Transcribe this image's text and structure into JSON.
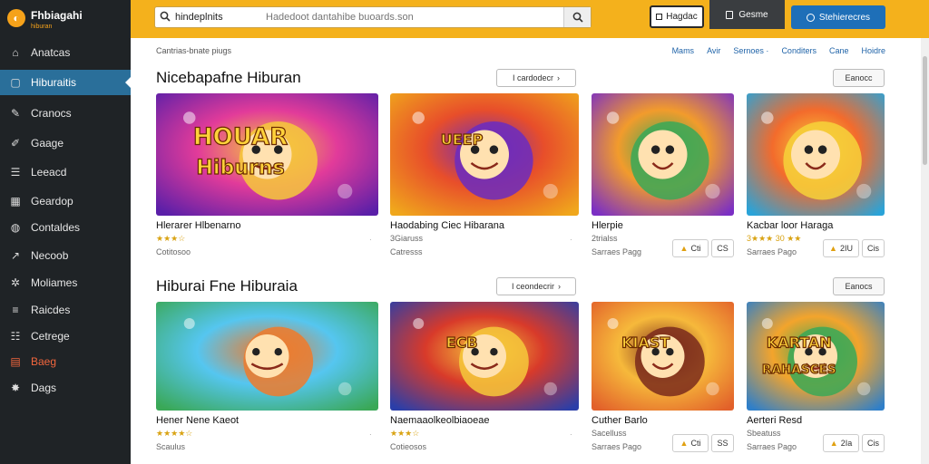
{
  "brand": {
    "name": "Fhbiagahi",
    "sub": "hiburan"
  },
  "sidebar": {
    "items": [
      {
        "label": "Anatcas",
        "icon": "home-icon"
      },
      {
        "label": "Hiburaitis",
        "icon": "square-icon"
      },
      {
        "label": "Cranocs",
        "icon": "wrench-icon"
      },
      {
        "label": "Gaage",
        "icon": "pencil-icon"
      },
      {
        "label": "Leeacd",
        "icon": "list-icon"
      },
      {
        "label": "Geardop",
        "icon": "calendar-icon"
      },
      {
        "label": "Contaldes",
        "icon": "globe-icon"
      },
      {
        "label": "Necoob",
        "icon": "chart-icon"
      },
      {
        "label": "Moliames",
        "icon": "settings-icon"
      },
      {
        "label": "Raicdes",
        "icon": "menu-icon"
      },
      {
        "label": "Cetrege",
        "icon": "sliders-icon"
      },
      {
        "label": "Baeg",
        "icon": "tag-icon"
      },
      {
        "label": "Dags",
        "icon": "bug-icon"
      }
    ]
  },
  "topbar": {
    "search_term": "hindeplnits",
    "search_placeholder": "Hadedoot dantahibe buoards.son",
    "login_label": "Hagdac",
    "store_label": "Gesme",
    "signup_label": "Stehierecres"
  },
  "main": {
    "breadcrumb": "Cantrias-bnate piugs",
    "subnav": [
      "Mams",
      "Avir",
      "Sernoes ·",
      "Conditers",
      "Cane",
      "Hoidre"
    ],
    "sections": [
      {
        "title": "Nicebapafne Hiburan",
        "view_all": "I cardodecr",
        "more": "Eanocc",
        "games": [
          {
            "title": "Hlerarer Hlbenarno",
            "rating": "★★★☆",
            "meta": "Cotitosoo",
            "dot": "·"
          },
          {
            "title": "Haodabing Ciec Hibarana",
            "rating": "3Giaruss",
            "meta": "Catresss",
            "dot": "·"
          },
          {
            "title": "Hlerpie",
            "rating": "2trialss",
            "meta": "Sarraes Pagg",
            "pill1": "Cti",
            "pill2": "CS"
          },
          {
            "title": "Kacbar loor Haraga",
            "rating": "3★★★ 30 ★★",
            "meta": "Sarraes Pago",
            "pill1": "2IU",
            "pill2": "Cis"
          }
        ]
      },
      {
        "title": "Hiburai Fne Hiburaia",
        "view_all": "I ceondecrir",
        "more": "Eanocs",
        "games": [
          {
            "title": "Hener Nene Kaeot",
            "rating": "★★★★☆",
            "meta": "Scaulus",
            "dot": "·"
          },
          {
            "title": "Naemaaolkeolbiaoeae",
            "rating": "★★★☆",
            "meta": "Cotieosos",
            "dot": "·"
          },
          {
            "title": "Cuther Barlo",
            "rating": "Sacelluss",
            "meta": "Sarraes Pago",
            "pill1": "Cti",
            "pill2": "SS"
          },
          {
            "title": "Aerteri Resd",
            "rating": "Sbeatuss",
            "meta": "Sarraes Pago",
            "pill1": "2Ia",
            "pill2": "Cis"
          }
        ]
      }
    ]
  },
  "colors": {
    "topbar": "#f4b11c",
    "sidebar": "#1f2326",
    "active": "#2a6f9a",
    "accent_blue": "#1e6fb8",
    "highlight": "#f2663d"
  },
  "thumb_art": [
    "HOUAR Hiburns",
    "UEEP",
    "",
    "",
    "",
    "ECB",
    "KIAST",
    "KARTAN RAHASCES"
  ]
}
